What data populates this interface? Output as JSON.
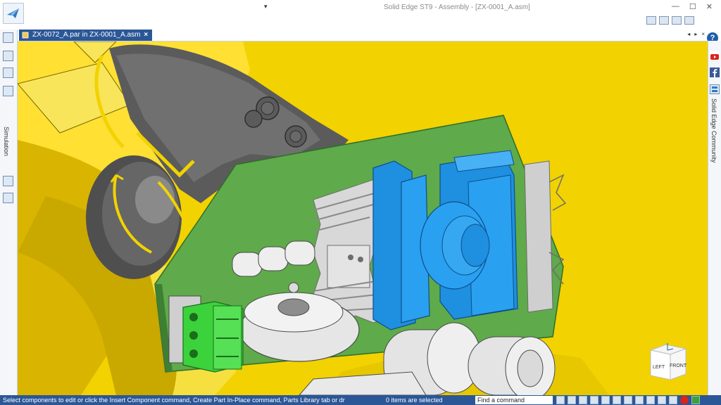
{
  "app": {
    "title": "Solid Edge ST9 - Assembly - [ZX-0001_A.asm]",
    "window_controls": [
      "—",
      "☐",
      "✕"
    ],
    "qat_dropdown": "▾"
  },
  "document_tabs": [
    {
      "label": "ZX-0072_A.par in ZX-0001_A.asm",
      "close": "×"
    }
  ],
  "tab_nav": {
    "left": "◂",
    "right": "▸",
    "close": "×"
  },
  "left_dock": {
    "simulation_label": "Simulation"
  },
  "right_dock": {
    "help": "?",
    "community_label": "Solid Edge Community"
  },
  "viewcube": {
    "left": "LEFT",
    "front": "FRONT"
  },
  "status": {
    "prompt": "Select components to edit or click the Insert Component command, Create Part In-Place command, Parts Library tab or dr",
    "selection": "0 items are selected",
    "find_placeholder": "Find a command"
  },
  "colors": {
    "ribbon_blue": "#2b5797",
    "housing_yellow": "#f2d200",
    "pcb_green": "#5faa4a",
    "bobbin_blue": "#1f8fe0",
    "terminal_green": "#3cd23c"
  },
  "icons": [
    "application-button-icon",
    "help-icon",
    "youtube-icon",
    "facebook-icon",
    "community-icon",
    "simulation-icon",
    "record-icon",
    "up-arrow-icon"
  ]
}
